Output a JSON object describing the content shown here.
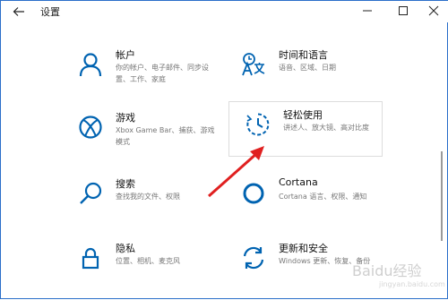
{
  "window": {
    "title": "设置"
  },
  "tiles": [
    {
      "title": "帐户",
      "desc": "你的帐户、电子邮件、同步设置、工作、家庭",
      "icon": "person-icon"
    },
    {
      "title": "时间和语言",
      "desc": "语音、区域、日期",
      "icon": "time-language-icon"
    },
    {
      "title": "游戏",
      "desc": "Xbox Game Bar、捕获、游戏模式",
      "icon": "xbox-icon"
    },
    {
      "title": "轻松使用",
      "desc": "讲述人、放大镜、高对比度",
      "icon": "ease-of-access-icon"
    },
    {
      "title": "搜索",
      "desc": "查找我的文件、权限",
      "icon": "search-icon"
    },
    {
      "title": "Cortana",
      "desc": "Cortana 语言、权限、通知",
      "icon": "cortana-icon"
    },
    {
      "title": "隐私",
      "desc": "位置、相机、麦克风",
      "icon": "lock-icon"
    },
    {
      "title": "更新和安全",
      "desc": "Windows 更新、恢复、备份",
      "icon": "update-icon"
    }
  ],
  "watermark": {
    "text": "Baidu经验",
    "sub": "jingyan.baidu.com"
  },
  "colors": {
    "accent": "#0063b1",
    "annotation": "#e02020"
  }
}
